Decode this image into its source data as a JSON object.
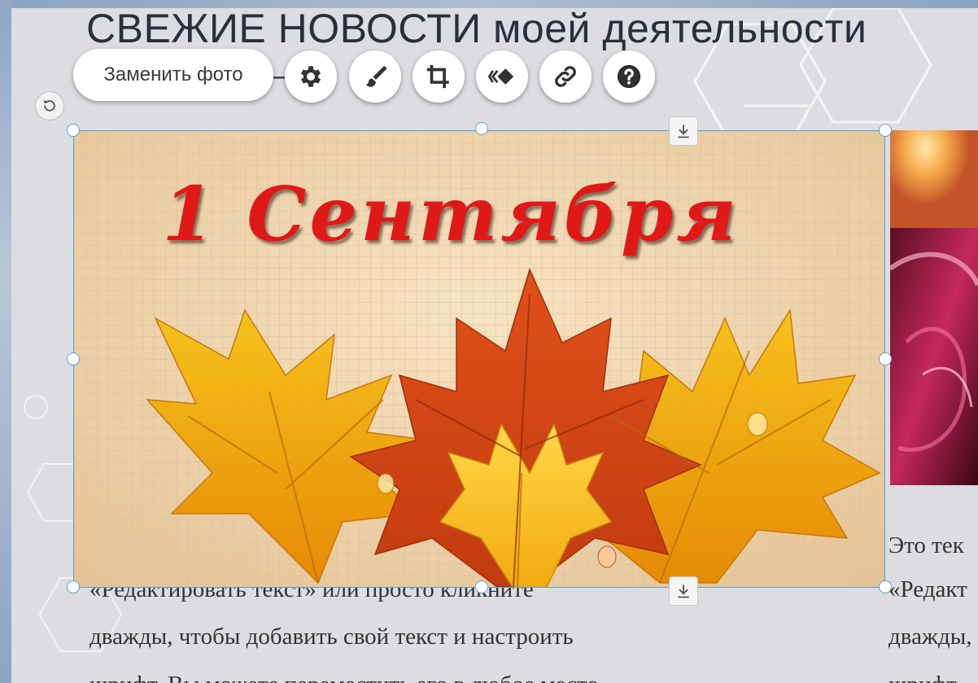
{
  "page": {
    "headline": "СВЕЖИЕ НОВОСТИ моей деятельности"
  },
  "toolbar": {
    "replace_photo_label": "Заменить фото",
    "tools": [
      {
        "name": "settings",
        "icon": "gear-icon"
      },
      {
        "name": "filter",
        "icon": "brush-icon"
      },
      {
        "name": "crop",
        "icon": "crop-icon"
      },
      {
        "name": "animation",
        "icon": "animation-icon"
      },
      {
        "name": "link",
        "icon": "link-icon"
      },
      {
        "name": "help",
        "icon": "question-icon"
      }
    ],
    "undo_icon": "rotate-left-icon"
  },
  "image": {
    "caption_text": "1 Сентября",
    "anchor_icon": "download-icon"
  },
  "left_column": {
    "line1": "«Редактировать текст» или просто кликните",
    "line2": "дважды, чтобы добавить свой текст и настроить",
    "line3": "шрифт. Вы можете переместить его в любое место"
  },
  "right_column": {
    "line0": "Это тек",
    "line1": "«Редакт",
    "line2": "дважды,",
    "line3": "шрифт."
  },
  "colors": {
    "selection": "#5a9fd6",
    "caption": "#e11818",
    "headline": "#2b2f3a"
  }
}
